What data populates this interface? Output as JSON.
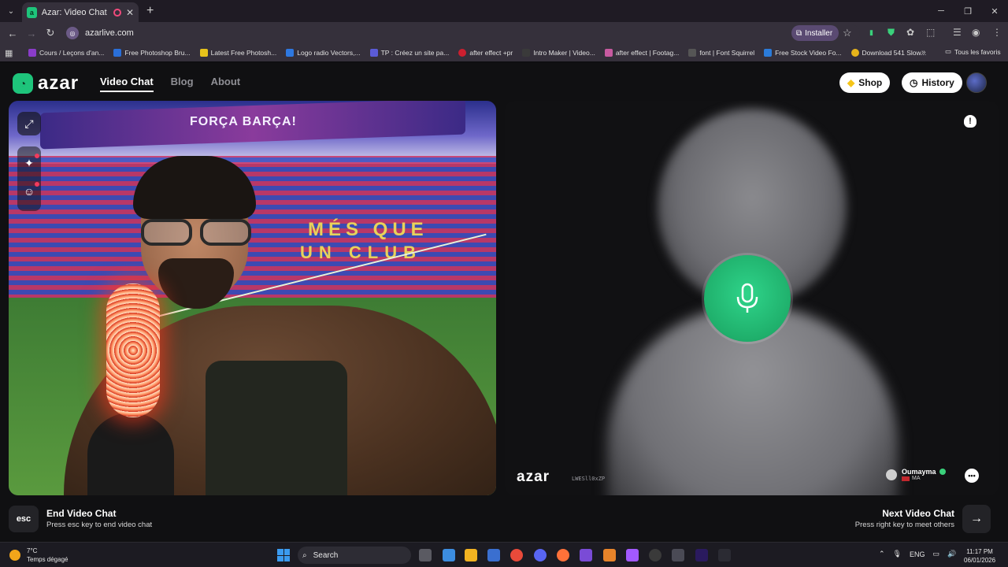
{
  "browser": {
    "tab_title": "Azar: Video Chat with New",
    "url": "azarlive.com",
    "install_label": "Installer",
    "bookmarks": [
      {
        "label": "Cours / Leçons d'an...",
        "color": "#8a3cc9"
      },
      {
        "label": "Free Photoshop Bru...",
        "color": "#2a6fd9"
      },
      {
        "label": "Latest Free Photosh...",
        "color": "#e6c21b"
      },
      {
        "label": "Logo radio Vectors,...",
        "color": "#2e78e0"
      },
      {
        "label": "TP : Créez un site pa...",
        "color": "#5b5bd6"
      },
      {
        "label": "after effect +pr",
        "color": "#cc1f2f"
      },
      {
        "label": "Intro Maker | Video...",
        "color": "#3a3a3a"
      },
      {
        "label": "after effect | Footag...",
        "color": "#c75aa0"
      },
      {
        "label": "font | Font Squirrel",
        "color": "#555"
      },
      {
        "label": "Free Stock Video Fo...",
        "color": "#2b7bd9"
      },
      {
        "label": "Download 541 Slow...",
        "color": "#e6b41b"
      }
    ],
    "all_bookmarks": "Tous les favoris"
  },
  "header": {
    "logo_text": "azar",
    "nav": [
      "Video Chat",
      "Blog",
      "About"
    ],
    "shop_label": "Shop",
    "history_label": "History"
  },
  "left_video": {
    "banner_text": "FORÇA BARÇA!",
    "stands_text_1": "MÉS QUE",
    "stands_text_2": "UN CLUB"
  },
  "right_video": {
    "watermark_logo": "azar",
    "watermark_id": "LWESll0xZP",
    "peer_name": "Oumayma",
    "peer_country": "MA",
    "accent": "#1fbf74"
  },
  "actions": {
    "esc_key": "esc",
    "end_title": "End Video Chat",
    "end_sub": "Press esc key to end video chat",
    "next_title": "Next Video Chat",
    "next_sub": "Press right key to meet others"
  },
  "taskbar": {
    "temp": "7°C",
    "weather": "Temps dégagé",
    "search": "Search",
    "lang": "ENG",
    "time": "11:17 PM",
    "date": "06/01/2026"
  }
}
